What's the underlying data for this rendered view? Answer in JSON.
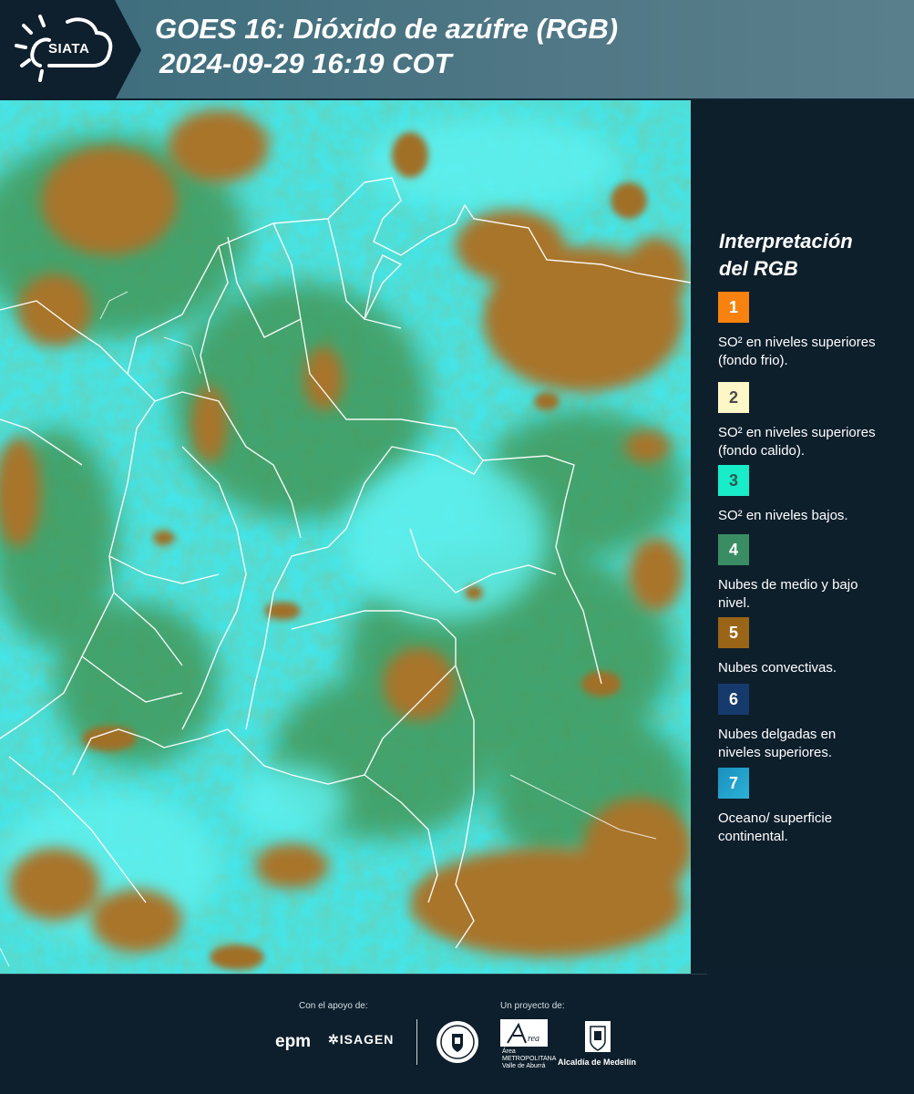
{
  "header": {
    "logo_text": "SIATA",
    "title_line1": "GOES 16: Dióxido de azúfre (RGB)",
    "title_line2": "2024-09-29 16:19 COT"
  },
  "legend": {
    "title_line1": "Interpretación",
    "title_line2": "del RGB",
    "items": [
      {
        "number": "1",
        "color": "#f7820f",
        "label": "SO² en niveles superiores (fondo frio)."
      },
      {
        "number": "2",
        "color": "#fdf6c6",
        "label": "SO² en niveles superiores (fondo calido)."
      },
      {
        "number": "3",
        "color": "#18ecc8",
        "label": "SO² en niveles bajos."
      },
      {
        "number": "4",
        "color": "#3a8d63",
        "label": "Nubes de medio y bajo nivel."
      },
      {
        "number": "5",
        "color": "#9a6517",
        "label": "Nubes convectivas."
      },
      {
        "number": "6",
        "color": "#173a6c",
        "label": "Nubes delgadas en niveles superiores."
      },
      {
        "number": "7",
        "color": "#1a8fbf",
        "label": "Oceano/ superficie continental."
      }
    ]
  },
  "footer": {
    "support_caption": "Con el apoyo de:",
    "project_caption": "Un proyecto de:",
    "epm": "epm",
    "isagen": "ISAGEN",
    "amva_text": "Área METROPOLITANA Valle de Aburrá",
    "alcaldia": "Alcaldía de Medellín"
  },
  "colors": {
    "header_band": "#4f7785",
    "background": "#0d1f2c",
    "cyan_surface": "#3fe7e6",
    "cloud_brown": "#a6742a",
    "cloud_green": "#3c8a46"
  }
}
